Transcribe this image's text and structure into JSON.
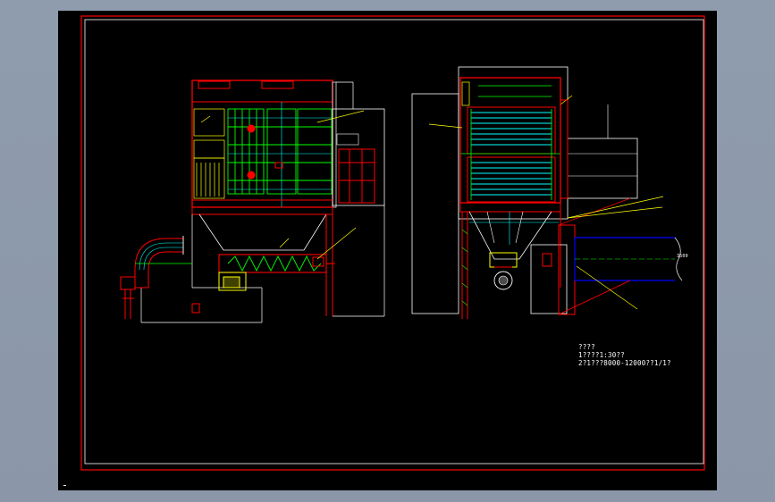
{
  "colors": {
    "background": "#8e9aab",
    "sheet": "#000000",
    "border": "#ff0000",
    "inner_border": "#ffffff",
    "cad_green": "#00ff00",
    "cad_cyan": "#00ffff",
    "cad_yellow": "#ffff00",
    "cad_blue": "#0000ff",
    "cad_red": "#ff0000",
    "cad_white": "#ffffff"
  },
  "notes": {
    "line1": "????",
    "line2": "1????1:30??",
    "line3": "2?1???8000-12000??1/1?"
  },
  "dimension_label": "3500"
}
